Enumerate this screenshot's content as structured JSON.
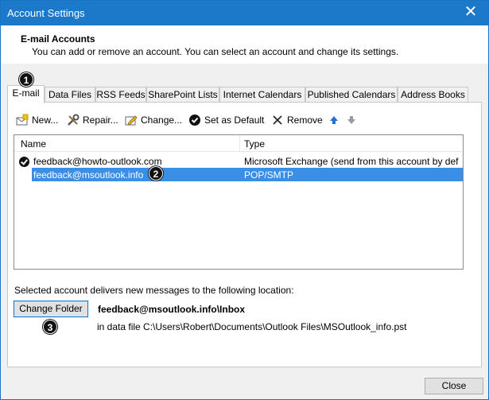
{
  "window": {
    "title": "Account Settings",
    "close_glyph": "✕"
  },
  "header": {
    "title": "E-mail Accounts",
    "description": "You can add or remove an account. You can select an account and change its settings."
  },
  "tabs": [
    {
      "label": "E-mail",
      "active": true
    },
    {
      "label": "Data Files"
    },
    {
      "label": "RSS Feeds"
    },
    {
      "label": "SharePoint Lists"
    },
    {
      "label": "Internet Calendars"
    },
    {
      "label": "Published Calendars"
    },
    {
      "label": "Address Books"
    }
  ],
  "toolbar": {
    "new": "New...",
    "repair": "Repair...",
    "change": "Change...",
    "set_default": "Set as Default",
    "remove": "Remove",
    "move_up_icon": "arrow-up-icon",
    "move_down_icon": "arrow-down-icon"
  },
  "accounts": {
    "columns": {
      "name": "Name",
      "type": "Type"
    },
    "rows": [
      {
        "name": "feedback@howto-outlook.com",
        "type": "Microsoft Exchange (send from this account by def...",
        "default": true
      },
      {
        "name": "feedback@msoutlook.info",
        "type": "POP/SMTP",
        "selected": true
      }
    ]
  },
  "delivery": {
    "caption": "Selected account delivers new messages to the following location:",
    "change_folder": "Change Folder",
    "folder_path": "feedback@msoutlook.info\\Inbox",
    "data_file": "in data file C:\\Users\\Robert\\Documents\\Outlook Files\\MSOutlook_info.pst"
  },
  "footer": {
    "close": "Close"
  },
  "badges": {
    "one": "1",
    "two": "2",
    "three": "3"
  },
  "colors": {
    "titlebar": "#1c79c9",
    "selection": "#3a8ee6",
    "focus_border": "#0078d7"
  }
}
